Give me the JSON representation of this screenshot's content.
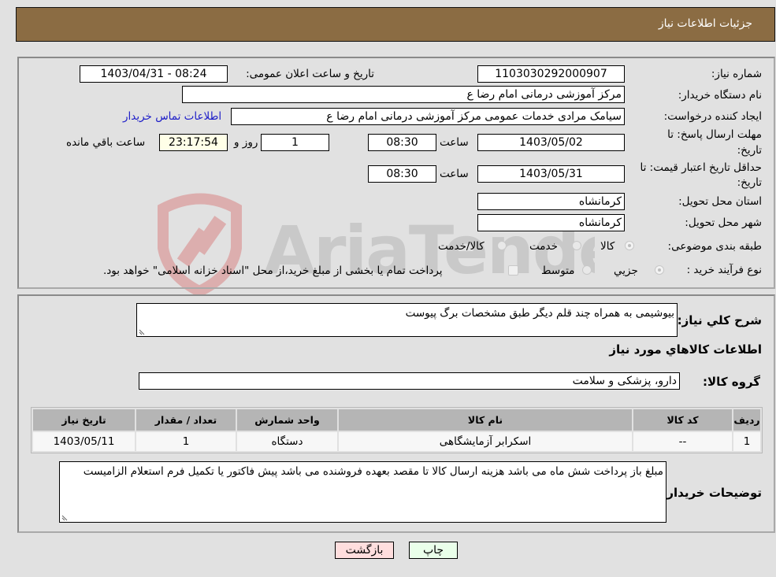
{
  "header": {
    "title": "جزئیات اطلاعات نیاز"
  },
  "details": {
    "need_number_label": "شماره نیاز:",
    "need_number": "1103030292000907",
    "announce_label": "تاریخ و ساعت اعلان عمومی:",
    "announce_value": "1403/04/31 - 08:24",
    "buyer_org_label": "نام دستگاه خریدار:",
    "buyer_org": "مرکز آموزشی  درمانی امام رضا  ع",
    "creator_label": "ایجاد کننده درخواست:",
    "creator": "سیامک مرادی خدمات عمومی مرکز آموزشی  درمانی امام رضا  ع",
    "contact_link": "اطلاعات تماس خریدار",
    "reply_deadline_label_line1": "مهلت ارسال پاسخ: تا",
    "reply_deadline_label_line2": "تاریخ:",
    "reply_date": "1403/05/02",
    "time_label": "ساعت",
    "reply_time": "08:30",
    "days_value": "1",
    "days_label": "روز و",
    "remaining_time": "23:17:54",
    "remaining_label": "ساعت باقي مانده",
    "price_validity_label_line1": "حداقل تاریخ اعتبار قیمت: تا",
    "price_validity_label_line2": "تاریخ:",
    "price_validity_date": "1403/05/31",
    "price_validity_time": "08:30",
    "province_label": "استان محل تحویل:",
    "province": "کرمانشاه",
    "city_label": "شهر محل تحویل:",
    "city": "کرمانشاه",
    "category_label": "طبقه بندی موضوعی:",
    "category_options": [
      "کالا",
      "خدمت",
      "کالا/خدمت"
    ],
    "category_selected": "کالا",
    "process_label": "نوع فرآیند خرید :",
    "process_options": [
      "جزيي",
      "متوسط"
    ],
    "process_selected": "جزيي",
    "treasury_note": "پرداخت تمام یا بخشی از مبلغ خرید،از محل \"اسناد خزانه اسلامی\" خواهد بود."
  },
  "description": {
    "label": "شرح کلي نياز:",
    "value": "بیوشیمی به همراه چند قلم دیگر طبق مشخصات  برگ پیوست"
  },
  "goods": {
    "section_title": "اطلاعات کالاهاي مورد نياز",
    "group_label": "گروه کالا:",
    "group_value": "دارو، پزشکی و سلامت",
    "columns": [
      "ردیف",
      "کد کالا",
      "نام کالا",
      "واحد شمارش",
      "تعداد / مقدار",
      "تاریخ نیاز"
    ],
    "rows": [
      [
        "1",
        "--",
        "اسکرابر آزمایشگاهی",
        "دستگاه",
        "1",
        "1403/05/11"
      ]
    ]
  },
  "buyer_notes": {
    "label": "توضیحات خریدار:",
    "value": "مبلغ باز پرداخت شش ماه می باشد هزینه ارسال کالا تا مقصد بعهده فروشنده می باشد پیش فاکتور یا تکمیل فرم استعلام الزامیست"
  },
  "buttons": {
    "print": "چاپ",
    "back": "بازگشت"
  },
  "colors": {
    "header_bg": "#8b6c43",
    "back_bg": "#ffdede",
    "print_bg": "#eaffea",
    "link": "#1c1cc8"
  },
  "watermark": {
    "text": "AriaTender.neT"
  }
}
